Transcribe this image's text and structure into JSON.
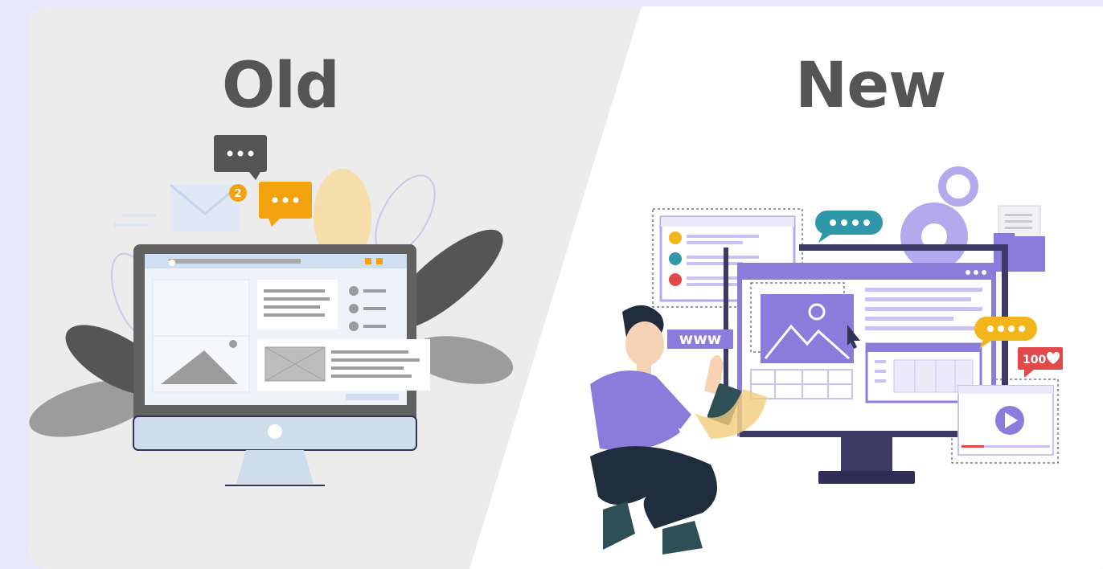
{
  "old_panel": {
    "title": "Old",
    "notification_count": "2",
    "colors": {
      "background": "#ececec",
      "accent_orange": "#f2a30f",
      "monitor_frame": "#616161"
    }
  },
  "new_panel": {
    "title": "New",
    "web_label": "www",
    "likes_label": "100",
    "colors": {
      "background": "#ffffff",
      "accent_purple": "#8b7cdc",
      "accent_teal": "#2e97a8",
      "accent_red": "#e2494b",
      "accent_yellow": "#f2b51c"
    }
  },
  "icons": [
    "chat-bubble-icon",
    "envelope-icon",
    "gear-icon",
    "folder-icon",
    "image-icon",
    "play-icon",
    "heart-icon",
    "cursor-icon"
  ]
}
